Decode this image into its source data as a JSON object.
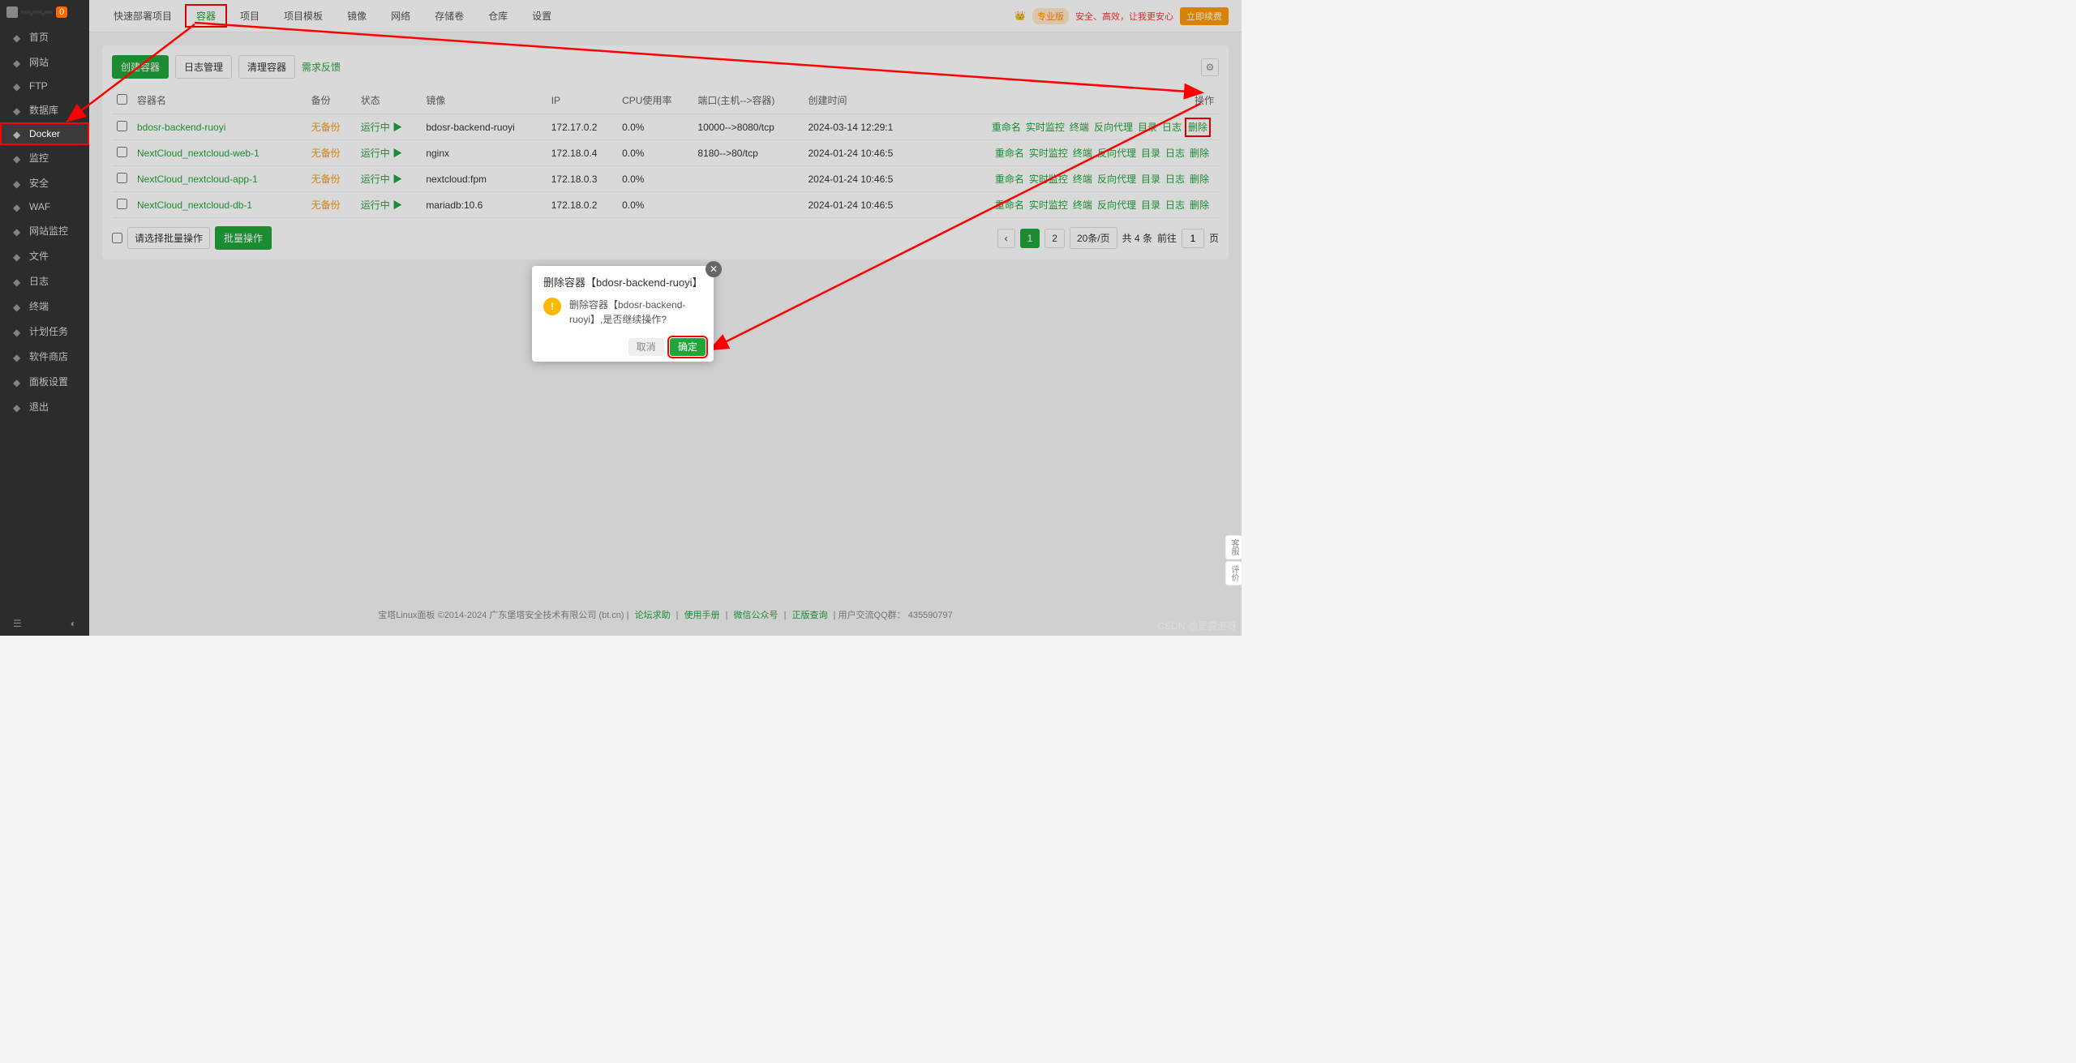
{
  "sidebar": {
    "badge": "0",
    "items": [
      {
        "label": "首页",
        "icon": "home"
      },
      {
        "label": "网站",
        "icon": "globe"
      },
      {
        "label": "FTP",
        "icon": "ftp"
      },
      {
        "label": "数据库",
        "icon": "db"
      },
      {
        "label": "Docker",
        "icon": "cloud",
        "active": true,
        "highlighted": true
      },
      {
        "label": "监控",
        "icon": "monitor"
      },
      {
        "label": "安全",
        "icon": "shield"
      },
      {
        "label": "WAF",
        "icon": "waf"
      },
      {
        "label": "网站监控",
        "icon": "sitemon"
      },
      {
        "label": "文件",
        "icon": "folder"
      },
      {
        "label": "日志",
        "icon": "log"
      },
      {
        "label": "终端",
        "icon": "terminal"
      },
      {
        "label": "计划任务",
        "icon": "cron"
      },
      {
        "label": "软件商店",
        "icon": "store"
      },
      {
        "label": "面板设置",
        "icon": "settings"
      },
      {
        "label": "退出",
        "icon": "exit"
      }
    ]
  },
  "topbar": {
    "tabs": [
      {
        "label": "快速部署项目"
      },
      {
        "label": "容器",
        "active": true,
        "highlighted": true
      },
      {
        "label": "项目"
      },
      {
        "label": "项目模板"
      },
      {
        "label": "镜像"
      },
      {
        "label": "网络"
      },
      {
        "label": "存储卷"
      },
      {
        "label": "仓库"
      },
      {
        "label": "设置"
      }
    ],
    "pro_badge": "专业版",
    "warn": "安全、高效，让我更安心",
    "buy": "立即续费"
  },
  "toolbar": {
    "create": "创建容器",
    "log": "日志管理",
    "clean": "清理容器",
    "feedback": "需求反馈"
  },
  "table": {
    "headers": [
      "容器名",
      "备份",
      "状态",
      "镜像",
      "IP",
      "CPU使用率",
      "端口(主机-->容器)",
      "创建时间",
      "操作"
    ],
    "rows": [
      {
        "name": "bdosr-backend-ruoyi",
        "backup": "无备份",
        "status": "运行中",
        "image": "bdosr-backend-ruoyi",
        "ip": "172.17.0.2",
        "cpu": "0.0%",
        "port": "10000-->8080/tcp",
        "time": "2024-03-14 12:29:1",
        "delete_hl": true
      },
      {
        "name": "NextCloud_nextcloud-web-1",
        "backup": "无备份",
        "status": "运行中",
        "image": "nginx",
        "ip": "172.18.0.4",
        "cpu": "0.0%",
        "port": "8180-->80/tcp",
        "time": "2024-01-24 10:46:5"
      },
      {
        "name": "NextCloud_nextcloud-app-1",
        "backup": "无备份",
        "status": "运行中",
        "image": "nextcloud:fpm",
        "ip": "172.18.0.3",
        "cpu": "0.0%",
        "port": "",
        "time": "2024-01-24 10:46:5"
      },
      {
        "name": "NextCloud_nextcloud-db-1",
        "backup": "无备份",
        "status": "运行中",
        "image": "mariadb:10.6",
        "ip": "172.18.0.2",
        "cpu": "0.0%",
        "port": "",
        "time": "2024-01-24 10:46:5"
      }
    ],
    "ops": [
      "重命名",
      "实时监控",
      "终端",
      "反向代理",
      "目录",
      "日志",
      "删除"
    ],
    "batch_select": "请选择批量操作",
    "batch_go": "批量操作"
  },
  "pagination": {
    "page1": "1",
    "page2": "2",
    "per_page": "20条/页",
    "total": "共 4 条",
    "goto": "前往",
    "goto_val": "1",
    "unit": "页"
  },
  "footer": {
    "copyright": "宝塔Linux面板 ©2014-2024 广东堡塔安全技术有限公司 (bt.cn)",
    "links": [
      "论坛求助",
      "使用手册",
      "微信公众号",
      "正版查询"
    ],
    "qq_label": "用户交流QQ群：",
    "qq": "435590797"
  },
  "modal": {
    "title": "删除容器【bdosr-backend-ruoyi】",
    "message": "删除容器【bdosr-backend-ruoyi】,是否继续操作?",
    "cancel": "取消",
    "ok": "确定"
  },
  "float": {
    "t1": "客服",
    "t2": "评价"
  },
  "watermark": "CSDN @是雾港呀"
}
